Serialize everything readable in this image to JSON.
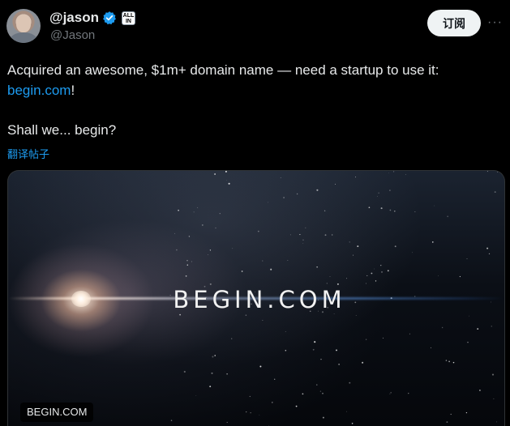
{
  "user": {
    "display_name": "@jason",
    "handle": "@Jason",
    "affiliate_badge": "ALL IN"
  },
  "actions": {
    "subscribe_label": "订阅",
    "more_icon": "more-horizontal-icon"
  },
  "tweet": {
    "text_line1": "Acquired an awesome, $1m+ domain name — need a startup to use it:",
    "link_text": "begin.com",
    "link_suffix": "!",
    "text_line3": "Shall we... begin?",
    "translate_label": "翻译帖子"
  },
  "media": {
    "image_title": "BEGIN.COM",
    "card_label": "BEGIN.COM"
  },
  "colors": {
    "background": "#000000",
    "text": "#e7e9ea",
    "secondary_text": "#71767b",
    "link": "#1d9bf0",
    "verified": "#1d9bf0",
    "button_bg": "#eff3f4"
  }
}
